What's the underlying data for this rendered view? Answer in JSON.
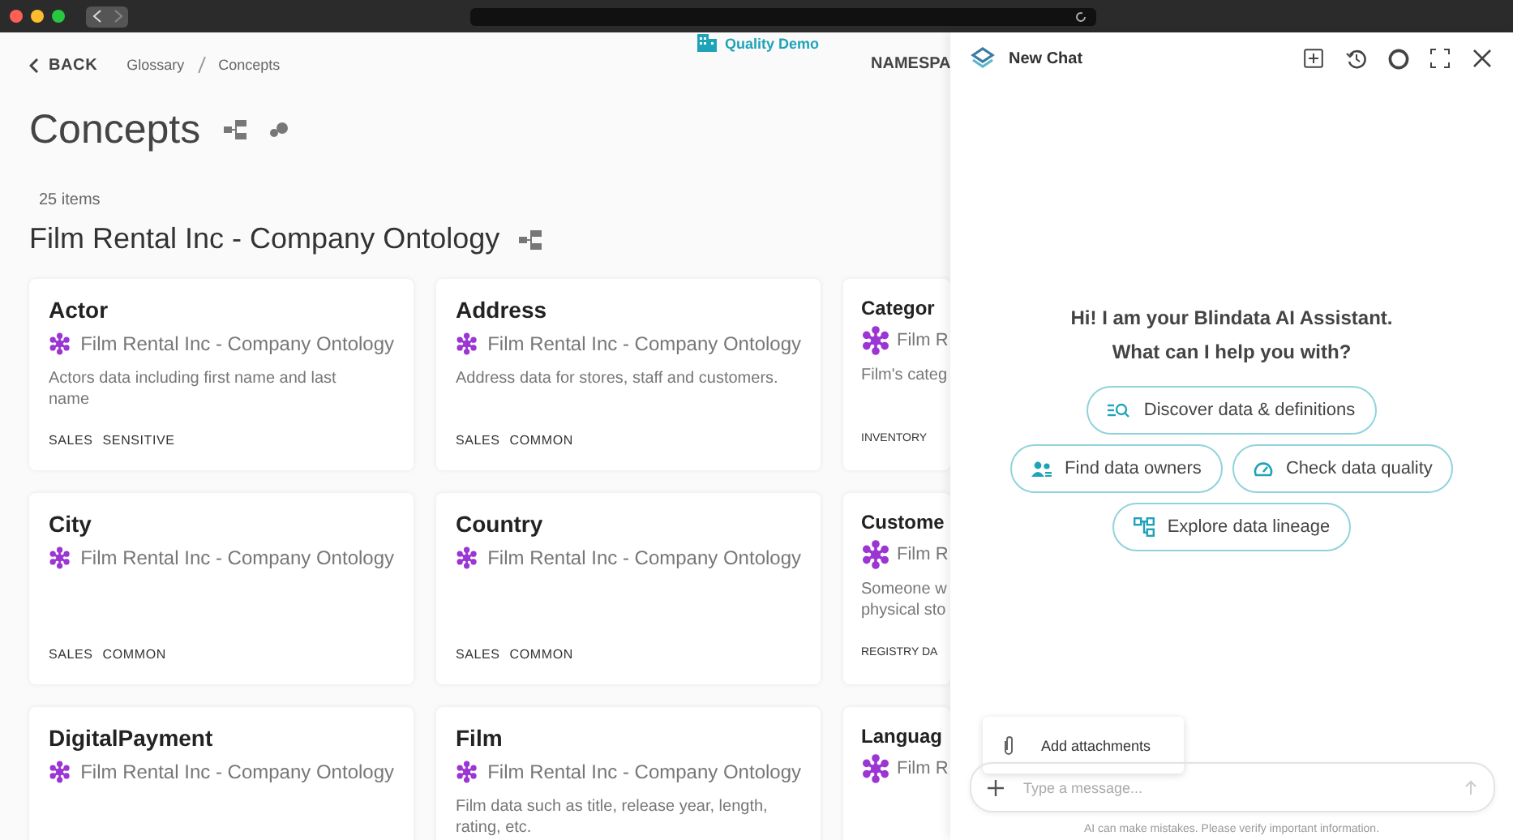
{
  "header": {
    "back": "BACK",
    "breadcrumbs": [
      "Glossary",
      "Concepts"
    ],
    "tenant": "Quality Demo",
    "namespace": "NAMESPA"
  },
  "page": {
    "title": "Concepts",
    "count": "25 items",
    "group_title": "Film Rental Inc - Company Ontology"
  },
  "cards": [
    {
      "kind": "full",
      "title": "Actor",
      "ontology": "Film Rental Inc - Company Ontology",
      "description_lines": [
        "Actors data including first name and last",
        "name"
      ],
      "tags": [
        "SALES",
        "SENSITIVE"
      ]
    },
    {
      "kind": "full",
      "title": "Address",
      "ontology": "Film Rental Inc - Company Ontology",
      "description_lines": [
        "Address data for stores, staff and customers."
      ],
      "tags": [
        "SALES",
        "COMMON"
      ]
    },
    {
      "kind": "partial",
      "title": "Categor",
      "ontology": "Film R",
      "description_lines": [
        "Film's categ"
      ],
      "tags": [
        "INVENTORY"
      ]
    },
    {
      "kind": "full",
      "title": "City",
      "ontology": "Film Rental Inc - Company Ontology",
      "tags": [
        "SALES",
        "COMMON"
      ]
    },
    {
      "kind": "full",
      "title": "Country",
      "ontology": "Film Rental Inc - Company Ontology",
      "tags": [
        "SALES",
        "COMMON"
      ]
    },
    {
      "kind": "partial",
      "title": "Custome",
      "ontology": "Film R",
      "description_lines": [
        "Someone w",
        "physical sto"
      ],
      "tags": [
        "REGISTRY DA"
      ]
    },
    {
      "kind": "full",
      "title": "DigitalPayment",
      "ontology": "Film Rental Inc - Company Ontology"
    },
    {
      "kind": "full",
      "title": "Film",
      "ontology": "Film Rental Inc - Company Ontology",
      "description_lines": [
        "Film data such as title, release year, length,",
        "rating, etc."
      ]
    },
    {
      "kind": "partial",
      "title": "Languag",
      "ontology": "Film R"
    }
  ],
  "chat": {
    "title": "New Chat",
    "greeting": [
      "Hi! I am your Blindata AI Assistant.",
      "What can I help you with?"
    ],
    "suggestions": [
      [
        {
          "label": "Discover data & definitions"
        }
      ],
      [
        {
          "label": "Find data owners"
        },
        {
          "label": "Check data quality"
        }
      ],
      [
        {
          "label": "Explore data lineage"
        }
      ]
    ],
    "menu": {
      "label": "Add attachments"
    },
    "input": {
      "placeholder": "Type a message..."
    },
    "disclaimer": "AI can make mistakes. Please verify important information."
  }
}
